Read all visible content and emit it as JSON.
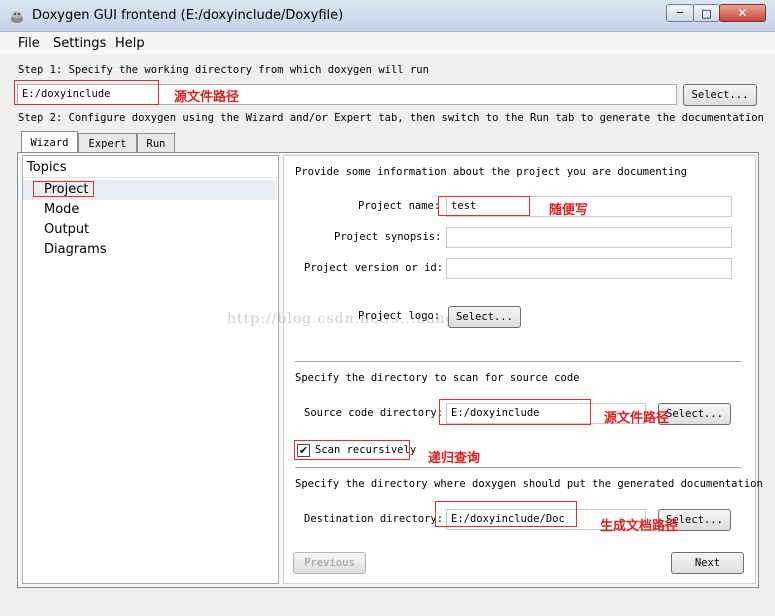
{
  "window": {
    "title": "Doxygen GUI frontend (E:/doxyinclude/Doxyfile)",
    "min_glyph": "─",
    "max_glyph": "□",
    "close_glyph": "✕"
  },
  "menu": {
    "file": "File",
    "settings": "Settings",
    "help": "Help"
  },
  "step1": {
    "text": "Step 1: Specify the working directory from which doxygen will run",
    "workdir_value": "E:/doxyinclude",
    "select_label": "Select..."
  },
  "step2": {
    "text": "Step 2: Configure doxygen using the Wizard and/or Expert tab, then switch to the Run tab to generate the documentation"
  },
  "tabs": {
    "wizard": "Wizard",
    "expert": "Expert",
    "run": "Run"
  },
  "topics": {
    "header": "Topics",
    "items": [
      "Project",
      "Mode",
      "Output",
      "Diagrams"
    ]
  },
  "project": {
    "intro": "Provide some information about the project you are documenting",
    "name_label": "Project name:",
    "name_value": "test",
    "synopsis_label": "Project synopsis:",
    "synopsis_value": "",
    "version_label": "Project version or id:",
    "version_value": "",
    "logo_label": "Project logo:",
    "logo_button": "Select..."
  },
  "source": {
    "intro": "Specify the directory to scan for source code",
    "label": "Source code directory:",
    "value": "E:/doxyinclude",
    "button": "Select...",
    "scan_label": "Scan recursively",
    "scan_checked": true
  },
  "destination": {
    "intro": "Specify the directory where doxygen should put the generated documentation",
    "label": "Destination directory:",
    "value": "E:/doxyinclude/Doc",
    "button": "Select..."
  },
  "nav": {
    "previous": "Previous",
    "next": "Next"
  },
  "annotations": {
    "workdir_note": "源文件路径",
    "name_note": "随便写",
    "source_note": "源文件路径",
    "scan_note": "递归查询",
    "dest_note": "生成文档路径"
  },
  "watermark": "http://blog.csdn.net/s...hang1",
  "colors": {
    "annotation": "#e02020",
    "titlebar": "#c4d3e6"
  }
}
